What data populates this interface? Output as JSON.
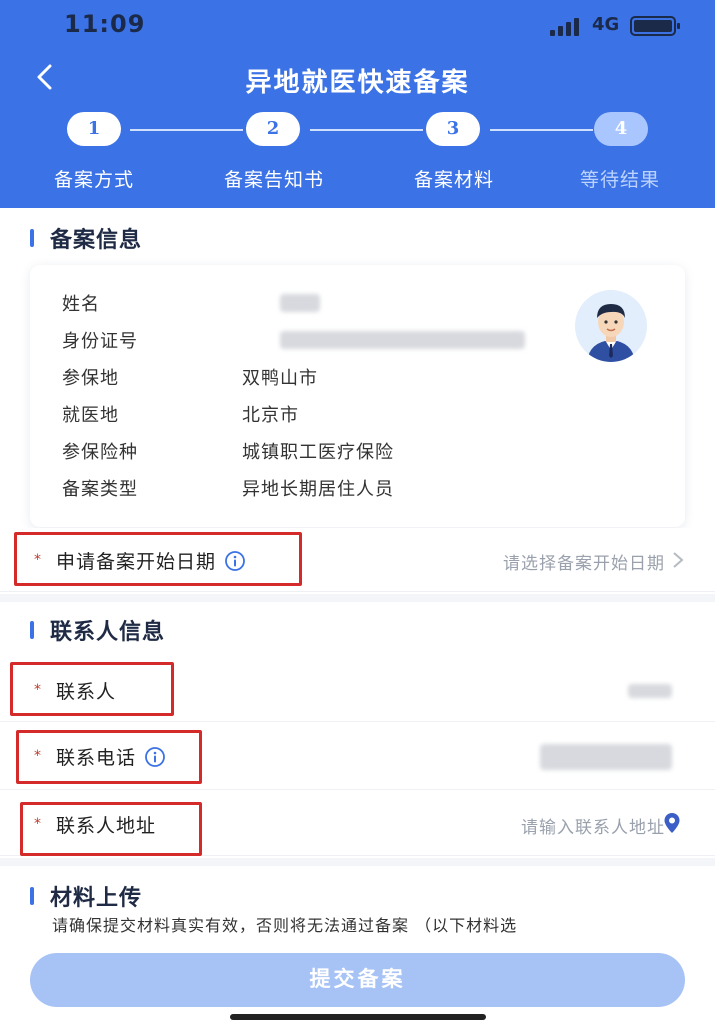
{
  "status_bar": {
    "time": "11:09",
    "network": "4G"
  },
  "header": {
    "title": "异地就医快速备案",
    "steps": [
      {
        "number": "1",
        "label": "备案方式"
      },
      {
        "number": "2",
        "label": "备案告知书"
      },
      {
        "number": "3",
        "label": "备案材料"
      },
      {
        "number": "4",
        "label": "等待结果"
      }
    ],
    "current_step": 3
  },
  "filing_info": {
    "section_title": "备案信息",
    "rows": [
      {
        "label": "姓名",
        "value": ""
      },
      {
        "label": "身份证号",
        "value": ""
      },
      {
        "label": "参保地",
        "value": "双鸭山市"
      },
      {
        "label": "就医地",
        "value": "北京市"
      },
      {
        "label": "参保险种",
        "value": "城镇职工医疗保险"
      },
      {
        "label": "备案类型",
        "value": "异地长期居住人员"
      }
    ]
  },
  "start_date": {
    "label": "申请备案开始日期",
    "placeholder": "请选择备案开始日期"
  },
  "contact_info": {
    "section_title": "联系人信息",
    "contact_label": "联系人",
    "phone_label": "联系电话",
    "address_label": "联系人地址",
    "address_placeholder": "请输入联系人地址"
  },
  "materials": {
    "section_title": "材料上传",
    "note": "请确保提交材料真实有效，否则将无法通过备案 （以下材料选"
  },
  "submit_label": "提交备案",
  "colors": {
    "primary": "#3b72e6",
    "highlight": "#d42a2a",
    "submit_disabled": "#a7c3f5"
  }
}
